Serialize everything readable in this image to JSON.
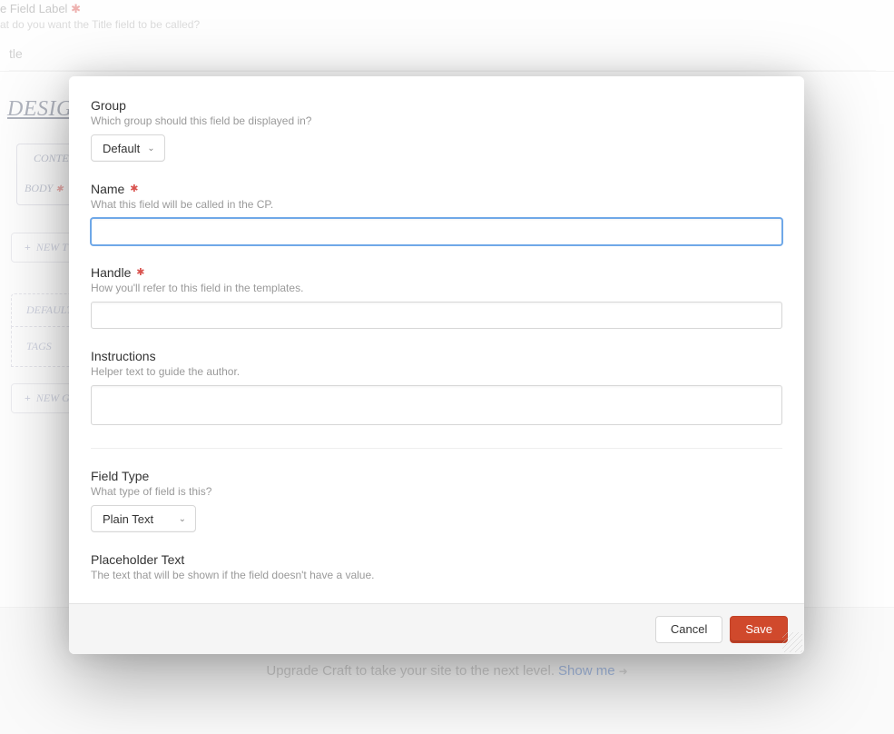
{
  "bg": {
    "title_label_prefix": "e Field Label",
    "title_help": "at do you want the Title field to be called?",
    "title_value": "tle",
    "designer_heading": "DESIGN",
    "tab_content": "CONTEN",
    "field_body": "BODY",
    "new_tab": "NEW T",
    "group_default": "DEFAULT",
    "group_tags": "TAGS",
    "new_group": "NEW G"
  },
  "footer": {
    "text": "Upgrade Craft to take your site to the next level.",
    "link": "Show me"
  },
  "modal": {
    "group": {
      "label": "Group",
      "help": "Which group should this field be displayed in?",
      "value": "Default"
    },
    "name": {
      "label": "Name",
      "help": "What this field will be called in the CP.",
      "value": ""
    },
    "handle": {
      "label": "Handle",
      "help": "How you'll refer to this field in the templates.",
      "value": ""
    },
    "instructions": {
      "label": "Instructions",
      "help": "Helper text to guide the author.",
      "value": ""
    },
    "field_type": {
      "label": "Field Type",
      "help": "What type of field is this?",
      "value": "Plain Text"
    },
    "placeholder_text": {
      "label": "Placeholder Text",
      "help": "The text that will be shown if the field doesn't have a value."
    },
    "buttons": {
      "cancel": "Cancel",
      "save": "Save"
    }
  }
}
